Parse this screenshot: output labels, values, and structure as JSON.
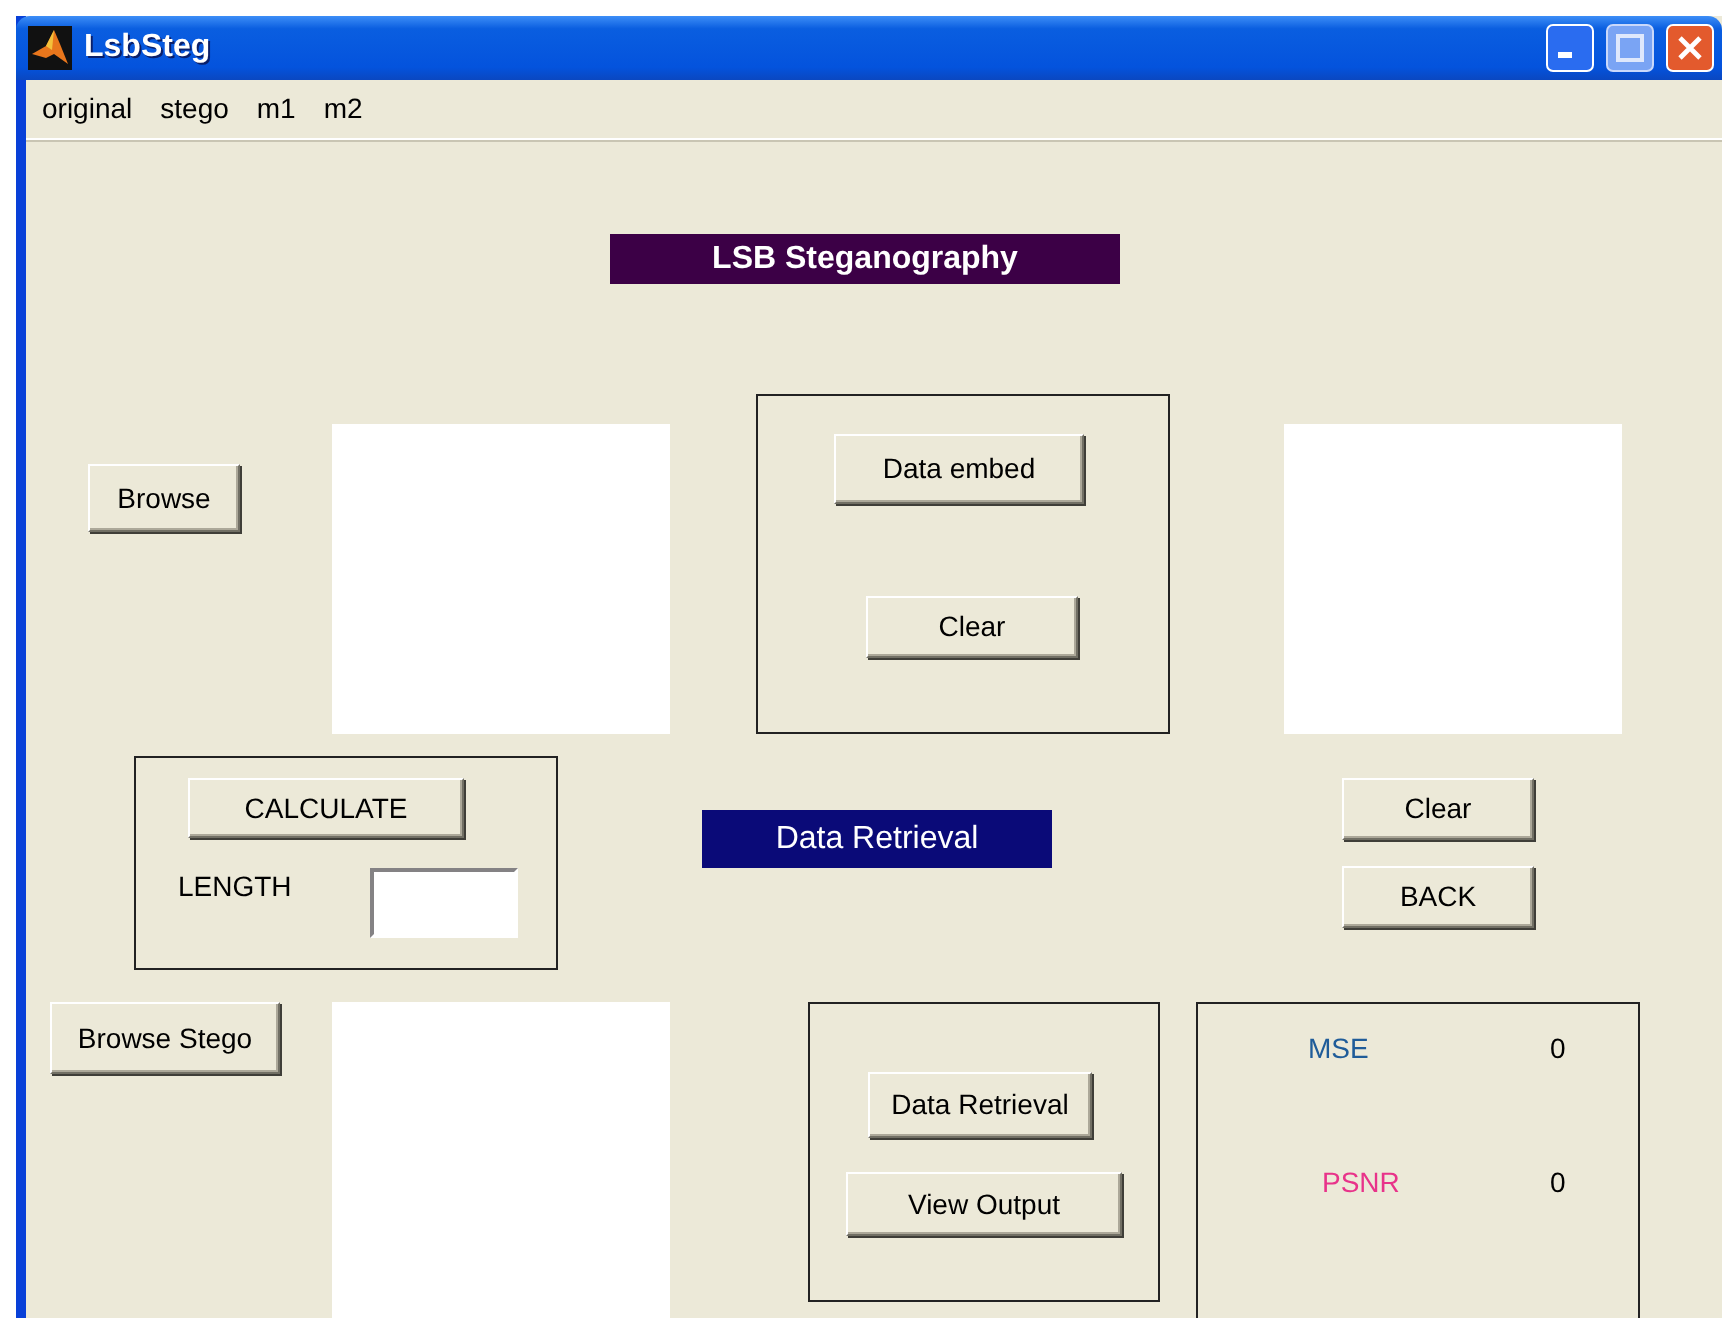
{
  "window": {
    "title": "LsbSteg"
  },
  "menu": [
    "original",
    "stego",
    "m1",
    "m2"
  ],
  "heading": "LSB Steganography",
  "section_label": "Data Retrieval",
  "buttons": [
    {
      "label": "Browse"
    },
    {
      "label": "Data embed"
    },
    {
      "label": "Clear"
    },
    {
      "label": "CALCULATE"
    },
    {
      "label": "Clear"
    },
    {
      "label": "BACK"
    },
    {
      "label": "Browse Stego"
    },
    {
      "label": "Data Retrieval"
    },
    {
      "label": "View Output"
    }
  ],
  "length_label": "LENGTH",
  "metrics": [
    {
      "name": "MSE",
      "color": "#1f5c99",
      "value": "0"
    },
    {
      "name": "PSNR",
      "color": "#e8338a",
      "value": "0"
    }
  ]
}
